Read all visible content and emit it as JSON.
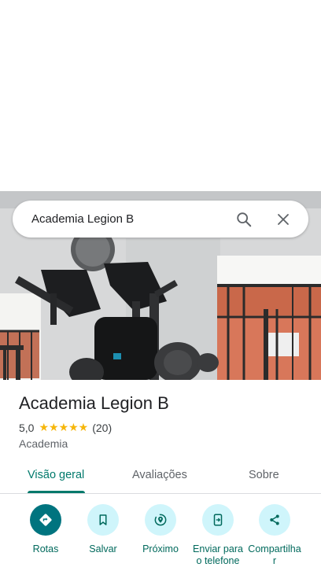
{
  "search": {
    "query": "Academia Legion B"
  },
  "place": {
    "title": "Academia Legion B",
    "rating": "5,0",
    "stars": "★★★★★",
    "review_count": "(20)",
    "category": "Academia"
  },
  "tabs": [
    {
      "label": "Visão geral",
      "active": true
    },
    {
      "label": "Avaliações",
      "active": false
    },
    {
      "label": "Sobre",
      "active": false
    }
  ],
  "actions": [
    {
      "label": "Rotas",
      "icon": "directions-icon"
    },
    {
      "label": "Salvar",
      "icon": "bookmark-icon"
    },
    {
      "label": "Próximo",
      "icon": "nearby-icon"
    },
    {
      "label": "Enviar para o telefone",
      "icon": "send-to-phone-icon"
    },
    {
      "label": "Compartilhar",
      "icon": "share-icon"
    }
  ],
  "colors": {
    "accent": "#00796b",
    "action_bg": "#cff5fb",
    "primary_action_bg": "#00747f",
    "star": "#f6b60b"
  }
}
